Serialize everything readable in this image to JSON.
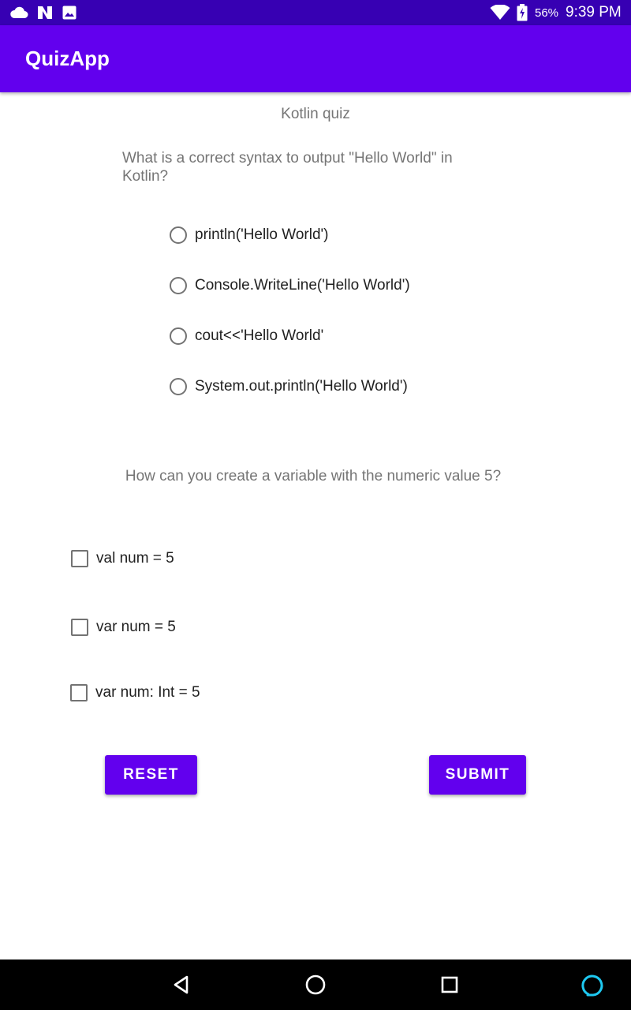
{
  "status_bar": {
    "battery_percent": "56%",
    "time": "9:39 PM",
    "icons": [
      "cloud-icon",
      "n-notification-icon",
      "image-icon",
      "wifi-icon",
      "battery-icon"
    ]
  },
  "app_bar": {
    "title": "QuizApp"
  },
  "quiz": {
    "heading": "Kotlin quiz",
    "question1": "What is a correct syntax to output \"Hello World\" in Kotlin?",
    "q1_options": [
      "println('Hello World')",
      "Console.WriteLine('Hello World')",
      "cout<<'Hello World'",
      "System.out.println('Hello World')"
    ],
    "question2": "How can you create a variable with the numeric value 5?",
    "q2_options": [
      "val num = 5",
      "var num = 5",
      "var num: Int = 5"
    ]
  },
  "buttons": {
    "reset": "RESET",
    "submit": "SUBMIT"
  },
  "colors": {
    "primary": "#6200ee",
    "primary_dark": "#3700b3",
    "assistant": "#1ec8f0"
  },
  "nav_bar": {
    "icons": [
      "back-icon",
      "home-icon",
      "recents-icon",
      "assistant-icon"
    ]
  }
}
